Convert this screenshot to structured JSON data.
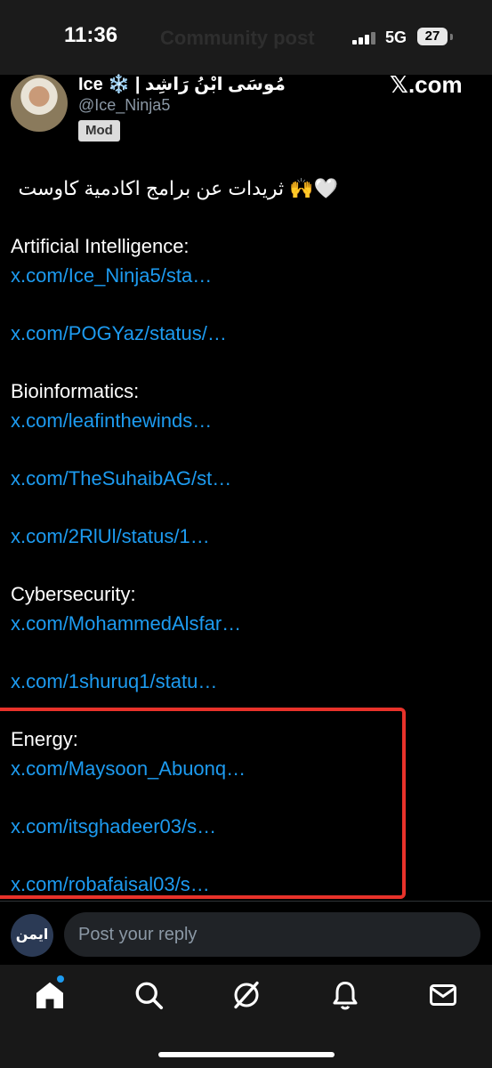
{
  "status_bar": {
    "time": "11:36",
    "network": "5G",
    "battery": "27",
    "background_title": "Community post"
  },
  "post": {
    "author_name": "Ice ❄️ | مُوسَى ابْنُ رَاشِد",
    "author_handle": "@Ice_Ninja5",
    "badge": "Mod",
    "brand": "𝕏.com",
    "lines": [
      {
        "type": "text",
        "text": "🤍🙌 ثريدات عن برامج اكادمية كاوست",
        "dir": "rtl"
      },
      {
        "type": "gap"
      },
      {
        "type": "text",
        "text": "Artificial Intelligence:"
      },
      {
        "type": "link",
        "text": "x.com/Ice_Ninja5/sta…"
      },
      {
        "type": "gap"
      },
      {
        "type": "link",
        "text": "x.com/POGYaz/status/…"
      },
      {
        "type": "gap"
      },
      {
        "type": "text",
        "text": "Bioinformatics:"
      },
      {
        "type": "link",
        "text": "x.com/leafinthewinds…"
      },
      {
        "type": "gap"
      },
      {
        "type": "link",
        "text": "x.com/TheSuhaibAG/st…"
      },
      {
        "type": "gap"
      },
      {
        "type": "link",
        "text": "x.com/2RlUl/status/1…"
      },
      {
        "type": "gap"
      },
      {
        "type": "text",
        "text": "Cybersecurity:"
      },
      {
        "type": "link",
        "text": "x.com/MohammedAlsfar…"
      },
      {
        "type": "gap"
      },
      {
        "type": "link",
        "text": "x.com/1shuruq1/statu…"
      },
      {
        "type": "gap"
      },
      {
        "type": "text",
        "text": "Energy:"
      },
      {
        "type": "link",
        "text": "x.com/Maysoon_Abuonq…"
      },
      {
        "type": "gap"
      },
      {
        "type": "link",
        "text": "x.com/itsghadeer03/s…"
      },
      {
        "type": "gap"
      },
      {
        "type": "link",
        "text": "x.com/robafaisal03/s…"
      }
    ]
  },
  "reply": {
    "placeholder": "Post your reply",
    "avatar_text": "ايمن"
  },
  "nav": [
    "home-icon",
    "search-icon",
    "grok-icon",
    "notifications-icon",
    "messages-icon"
  ],
  "colors": {
    "link": "#1d9bf0",
    "highlight": "#e8322a"
  }
}
